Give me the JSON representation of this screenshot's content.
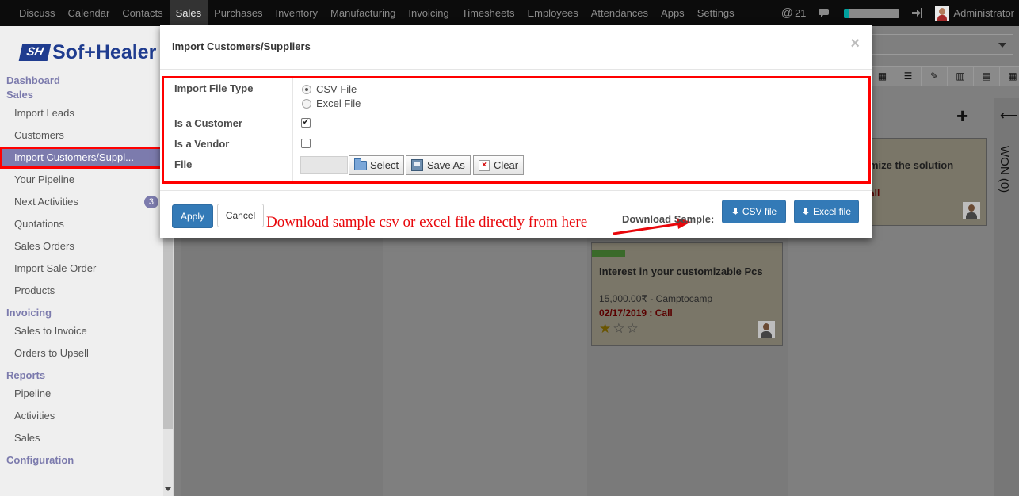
{
  "topbar": {
    "menu": [
      "Discuss",
      "Calendar",
      "Contacts",
      "Sales",
      "Purchases",
      "Inventory",
      "Manufacturing",
      "Invoicing",
      "Timesheets",
      "Employees",
      "Attendances",
      "Apps",
      "Settings"
    ],
    "active_menu": "Sales",
    "mentions_count": "21",
    "progress_fraction": 0.08,
    "user_name": "Administrator",
    "icons": [
      "at-icon",
      "chat-icon",
      "login-icon",
      "avatar"
    ]
  },
  "sidebar": {
    "logo_mark": "SH",
    "logo_text": "Sof+Healer",
    "sections": [
      {
        "title": "Dashboard",
        "items": []
      },
      {
        "title": "Sales",
        "items": [
          "Import Leads",
          "Customers",
          "Import Customers/Suppl...",
          "Your Pipeline",
          "Next Activities",
          "Quotations",
          "Sales Orders",
          "Import Sale Order",
          "Products"
        ]
      },
      {
        "title": "Invoicing",
        "items": [
          "Sales to Invoice",
          "Orders to Upsell"
        ]
      },
      {
        "title": "Reports",
        "items": [
          "Pipeline",
          "Activities",
          "Sales"
        ]
      },
      {
        "title": "Configuration",
        "items": []
      }
    ],
    "selected_item": "Import Customers/Suppl...",
    "next_activities_badge": "3"
  },
  "background": {
    "card_partial_title": "mize the solution",
    "card_partial_due": "all",
    "folded_column_label": "WON (0)",
    "card": {
      "title": "Interest in your customizable Pcs",
      "amount": "15,000.00₹ - Camptocamp",
      "due": "02/17/2019 : Call",
      "stars": 1,
      "stars_max": 3
    }
  },
  "modal": {
    "title": "Import Customers/Suppliers",
    "close_glyph": "×",
    "fields": {
      "import_file_type_label": "Import File Type",
      "options": [
        "CSV File",
        "Excel File"
      ],
      "selected_option": "CSV File",
      "is_customer_label": "Is a Customer",
      "is_customer_checked": true,
      "is_vendor_label": "Is a Vendor",
      "is_vendor_checked": false,
      "file_label": "File",
      "select_label": "Select",
      "save_as_label": "Save As",
      "clear_label": "Clear"
    },
    "footer": {
      "apply_label": "Apply",
      "cancel_label": "Cancel",
      "annotation": "Download sample csv or excel file directly from here",
      "download_sample_label": "Download Sample:",
      "csv_button": "CSV file",
      "excel_button": "Excel file"
    }
  },
  "colors": {
    "accent": "#7c7bad",
    "primary_button": "#337ab7",
    "highlight_border": "#ff0000",
    "annotation_text": "#e8070b"
  }
}
